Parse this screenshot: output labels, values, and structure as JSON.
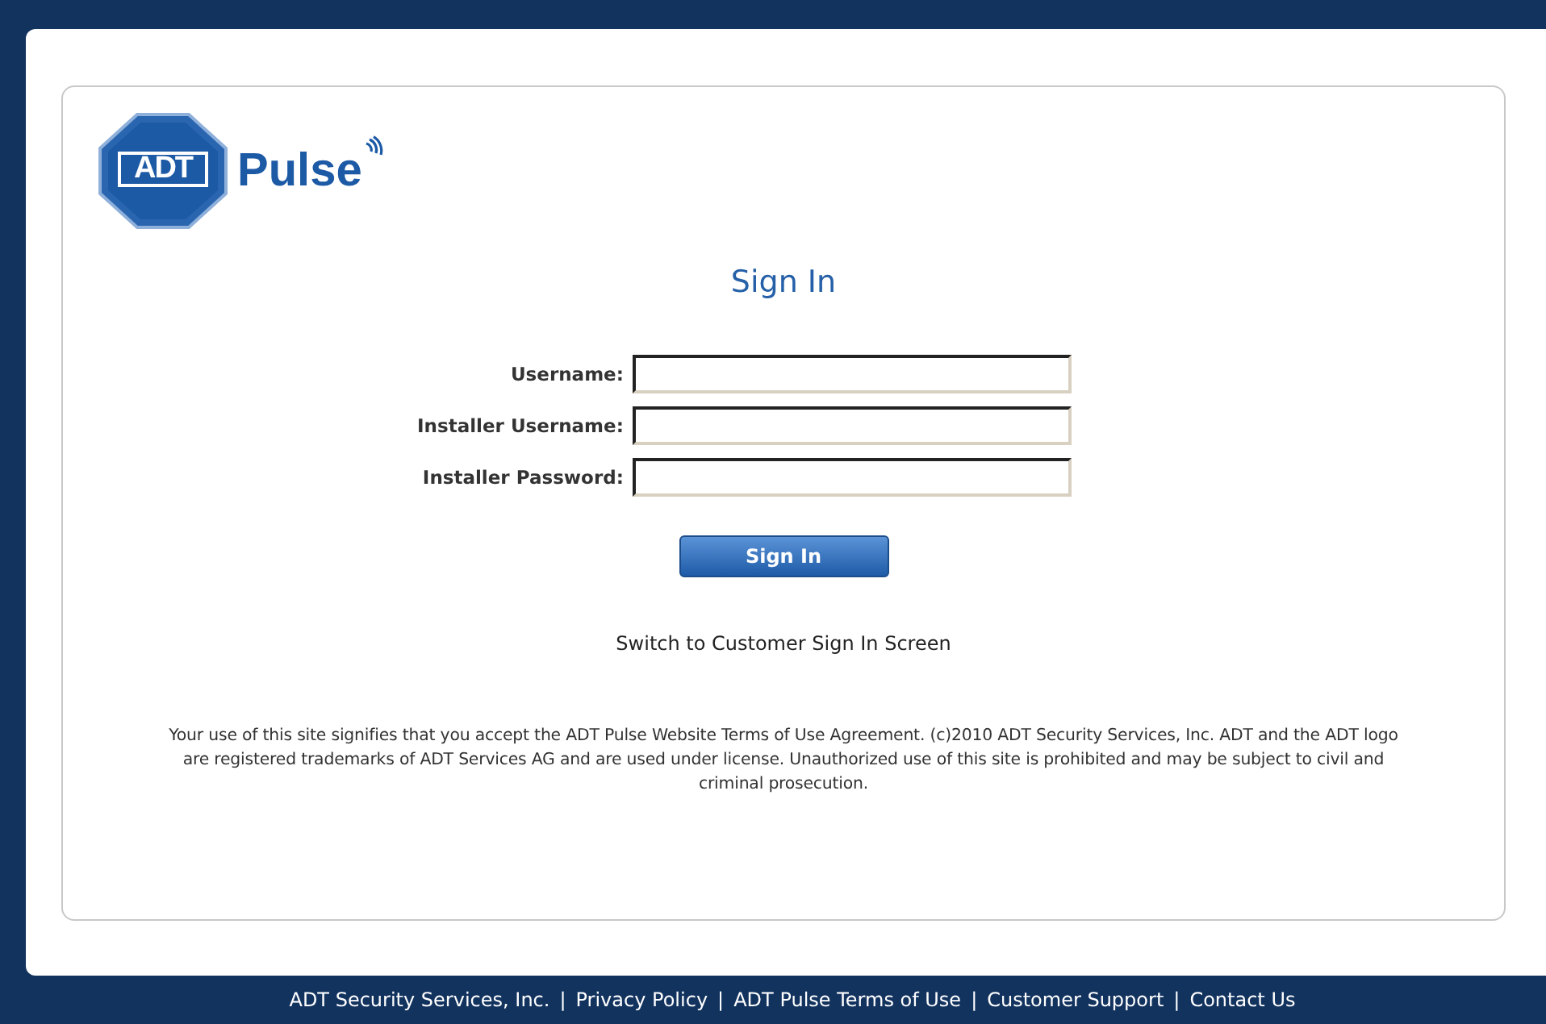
{
  "logo": {
    "badge": "ADT",
    "wordmark": "Pulse"
  },
  "heading": "Sign In",
  "fields": [
    {
      "label": "Username:"
    },
    {
      "label": "Installer Username:"
    },
    {
      "label": "Installer Password:"
    }
  ],
  "submit": "Sign In",
  "switch_link": "Switch to Customer Sign In Screen",
  "legal": "Your use of this site signifies that you accept the ADT Pulse Website Terms of Use Agreement. (c)2010 ADT Security Services, Inc. ADT and the ADT logo are registered trademarks of ADT Services AG and are used under license. Unauthorized use of this site is prohibited and may be subject to civil and criminal prosecution.",
  "footer": {
    "separator": "|",
    "links": [
      "ADT Security Services, Inc.",
      "Privacy Policy",
      "ADT Pulse Terms of Use",
      "Customer Support",
      "Contact Us"
    ]
  }
}
